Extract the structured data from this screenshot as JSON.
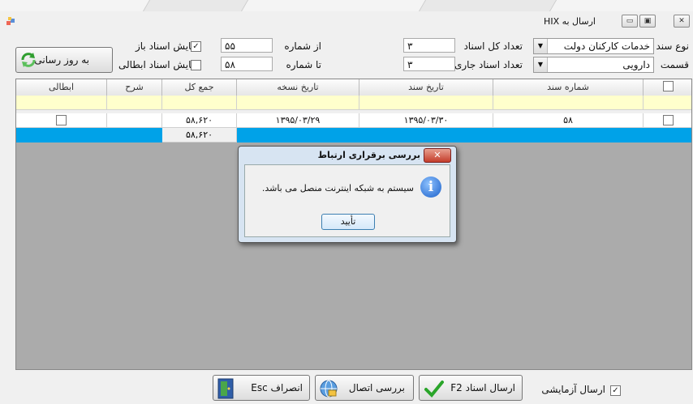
{
  "window": {
    "title": "ارسال به HIX",
    "minimize": "▭",
    "maximize": "▣",
    "close": "✕"
  },
  "filters": {
    "doc_type_label": "نوع سند",
    "doc_type_value": "خدمات کارکنان دولت",
    "section_label": "قسمت",
    "section_value": "دارویی",
    "total_docs_label": "تعداد کل اسناد",
    "total_docs_value": "۳",
    "current_docs_label": "تعداد اسناد جاری",
    "current_docs_value": "۳",
    "from_number_label": "از شماره",
    "from_number_value": "۵۵",
    "to_number_label": "تا شماره",
    "to_number_value": "۵۸",
    "show_open_label": "نمایش اسناد باز",
    "show_open_checked": true,
    "show_cancelled_label": "نمایش اسناد ابطالی",
    "show_cancelled_checked": false,
    "refresh_label": "به روز رسانی"
  },
  "grid": {
    "columns": [
      "",
      "شماره سند",
      "تاریخ سند",
      "تاریخ نسخه",
      "جمع کل",
      "شرح",
      "ابطالی"
    ],
    "rows": [
      {
        "doc_no": "۵۸",
        "doc_date": "۱۳۹۵/۰۳/۳۰",
        "rx_date": "۱۳۹۵/۰۳/۲۹",
        "total": "۵۸,۶۲۰",
        "desc": ""
      }
    ],
    "footer_total": "۵۸,۶۲۰"
  },
  "dialog": {
    "title": "بررسی برقراری ارتباط",
    "close": "✕",
    "message": "سیستم به شبکه اینترنت منصل می باشد.",
    "ok_label": "تأیید"
  },
  "bottom": {
    "test_send_label": "ارسال آزمایشی",
    "test_send_checked": true,
    "send_label": "ارسال اسناد F2",
    "check_label": "بررسی اتصال",
    "cancel_label": "انصراف Esc"
  },
  "colors": {
    "selection": "#00a2e8",
    "new_row": "#ffffcc",
    "accent": "#3a8ee6"
  }
}
